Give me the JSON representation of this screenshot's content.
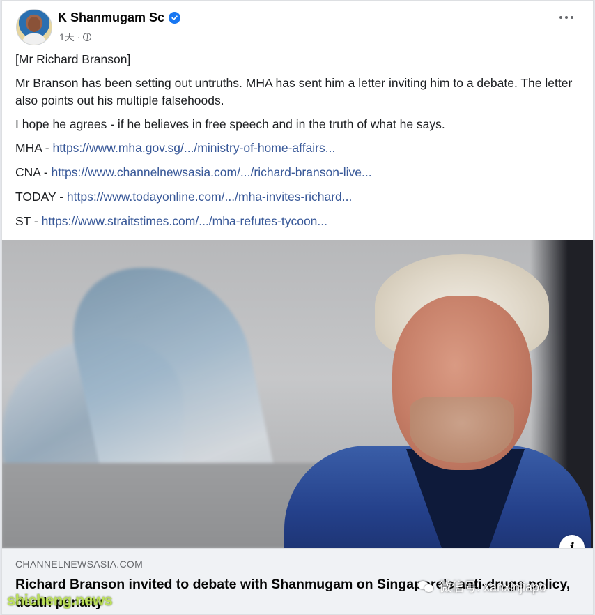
{
  "post": {
    "author": "K Shanmugam Sc",
    "timestamp": "1天 ·",
    "lines": {
      "title": "[Mr Richard Branson]",
      "p1": "Mr Branson has been setting out untruths. MHA has sent him a letter inviting him to a debate. The letter also points out his multiple falsehoods.",
      "p2": "I hope he agrees - if he believes in free speech and in the truth of what he says."
    },
    "links": [
      {
        "label": "MHA - ",
        "url": "https://www.mha.gov.sg/.../ministry-of-home-affairs..."
      },
      {
        "label": "CNA - ",
        "url": "https://www.channelnewsasia.com/.../richard-branson-live..."
      },
      {
        "label": "TODAY - ",
        "url": "https://www.todayonline.com/.../mha-invites-richard..."
      },
      {
        "label": "ST - ",
        "url": "https://www.straitstimes.com/.../mha-refutes-tycoon..."
      }
    ]
  },
  "preview": {
    "domain": "CHANNELNEWSASIA.COM",
    "headline": "Richard Branson invited to debate with Shanmugam on Singapore's anti-drugs policy, death penalty",
    "info_icon": "info-icon"
  },
  "watermarks": {
    "left": "shicheng.news",
    "right": "微信号: xanxinjiapo"
  },
  "colors": {
    "link": "#385898",
    "verified": "#1877f2",
    "meta": "#65676b"
  }
}
